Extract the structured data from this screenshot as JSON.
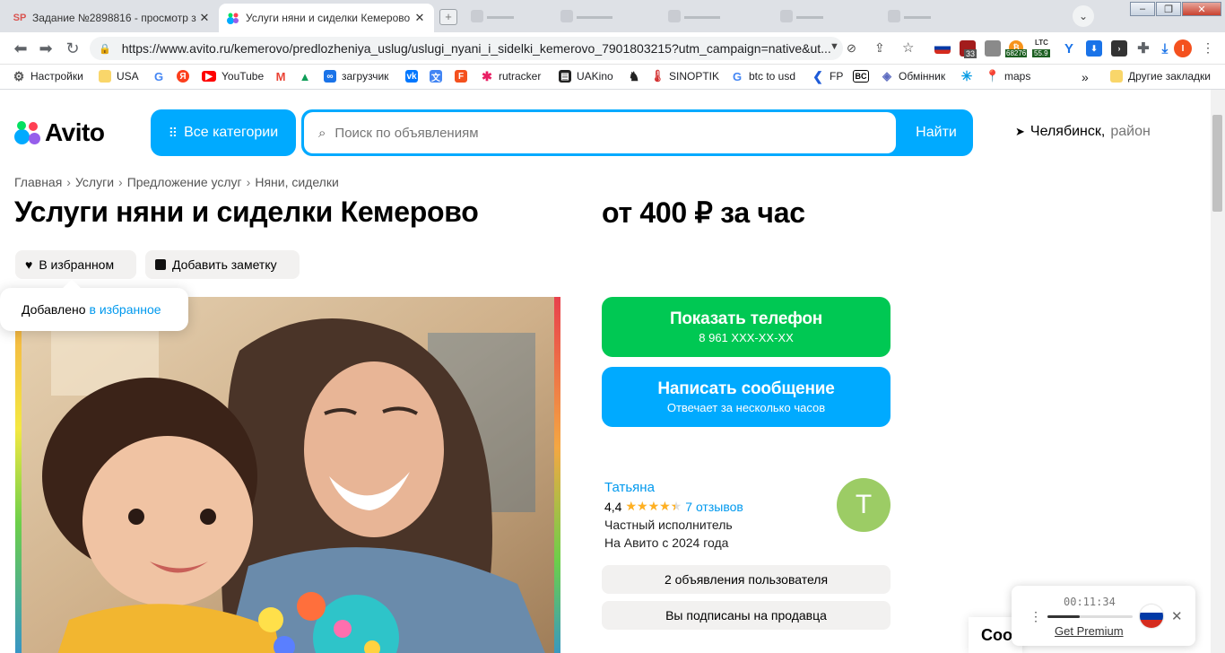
{
  "browser": {
    "tabs": [
      {
        "favicon": "SP",
        "title": "Задание №2898816 - просмотр з"
      },
      {
        "favicon": "avito-dots",
        "title": "Услуги няни и сиделки Кемерово"
      }
    ],
    "url": "https://www.avito.ru/kemerovo/predlozheniya_uslug/uslugi_nyani_i_sidelki_kemerovo_7901803215?utm_campaign=native&ut...",
    "extensions": {
      "badge_1": "33",
      "ltc_label": "LTC",
      "ltc_value": "55.9",
      "btc_value": "68276"
    },
    "bookmarks": [
      {
        "icon": "gear-icon",
        "label": "Настройки"
      },
      {
        "icon": "folder-icon",
        "label": "USA"
      },
      {
        "icon": "google-icon",
        "label": ""
      },
      {
        "icon": "yandex-icon",
        "label": ""
      },
      {
        "icon": "youtube-icon",
        "label": "YouTube"
      },
      {
        "icon": "gmail-icon",
        "label": ""
      },
      {
        "icon": "drive-icon",
        "label": ""
      },
      {
        "icon": "infinity-icon",
        "label": "загрузчик"
      },
      {
        "icon": "vk-icon",
        "label": ""
      },
      {
        "icon": "translate-icon",
        "label": ""
      },
      {
        "icon": "f-icon",
        "label": ""
      },
      {
        "icon": "rutracker-icon",
        "label": "rutracker"
      },
      {
        "icon": "uakino-icon",
        "label": "UAKino"
      },
      {
        "icon": "chess-icon",
        "label": ""
      },
      {
        "icon": "thermometer-icon",
        "label": "SINOPTIK"
      },
      {
        "icon": "google-icon",
        "label": "btc to usd"
      },
      {
        "icon": "fp-icon",
        "label": "FP"
      },
      {
        "icon": "bc-icon",
        "label": ""
      },
      {
        "icon": "exchange-icon",
        "label": "Обмінник"
      },
      {
        "icon": "walmart-icon",
        "label": ""
      },
      {
        "icon": "maps-icon",
        "label": "maps"
      }
    ],
    "other_bookmarks": "Другие закладки",
    "more_bookmarks": "»"
  },
  "header": {
    "logo": "Avito",
    "categories_button": "Все категории",
    "search_placeholder": "Поиск по объявлениям",
    "search_button": "Найти",
    "location_city": "Челябинск,",
    "location_area": "район"
  },
  "breadcrumb": [
    "Главная",
    "Услуги",
    "Предложение услуг",
    "Няни, сиделки"
  ],
  "breadcrumb_sep": "›",
  "listing": {
    "title": "Услуги няни и сиделки Кемерово",
    "price": "от 400 ₽ за час",
    "favorite_label": "В избранном",
    "note_label": "Добавить заметку",
    "tooltip_text": "Добавлено",
    "tooltip_link": "в избранное"
  },
  "actions": {
    "phone_label": "Показать телефон",
    "phone_number": "8 961 XXX-XX-XX",
    "message_label": "Написать сообщение",
    "message_sub": "Отвечает за несколько часов"
  },
  "seller": {
    "name": "Татьяна",
    "rating": "4,4",
    "rating_value": 4.4,
    "stars": "★★★★★",
    "reviews": "7 отзывов",
    "type": "Частный исполнитель",
    "since": "На Авито с 2024 года",
    "avatar_letter": "Т",
    "ads_button": "2 объявления пользователя",
    "subscribed_button": "Вы подписаны на продавца"
  },
  "overlay": {
    "cookie_text": "Coo",
    "player_time": "00:11:34",
    "player_progress": 0.38,
    "player_premium": "Get Premium"
  },
  "colors": {
    "avito_blue": "#00aaff",
    "avito_green": "#00c853",
    "link_blue": "#0099ee",
    "avatar_green": "#9ccc65",
    "chip_gray": "#f2f1f0"
  }
}
